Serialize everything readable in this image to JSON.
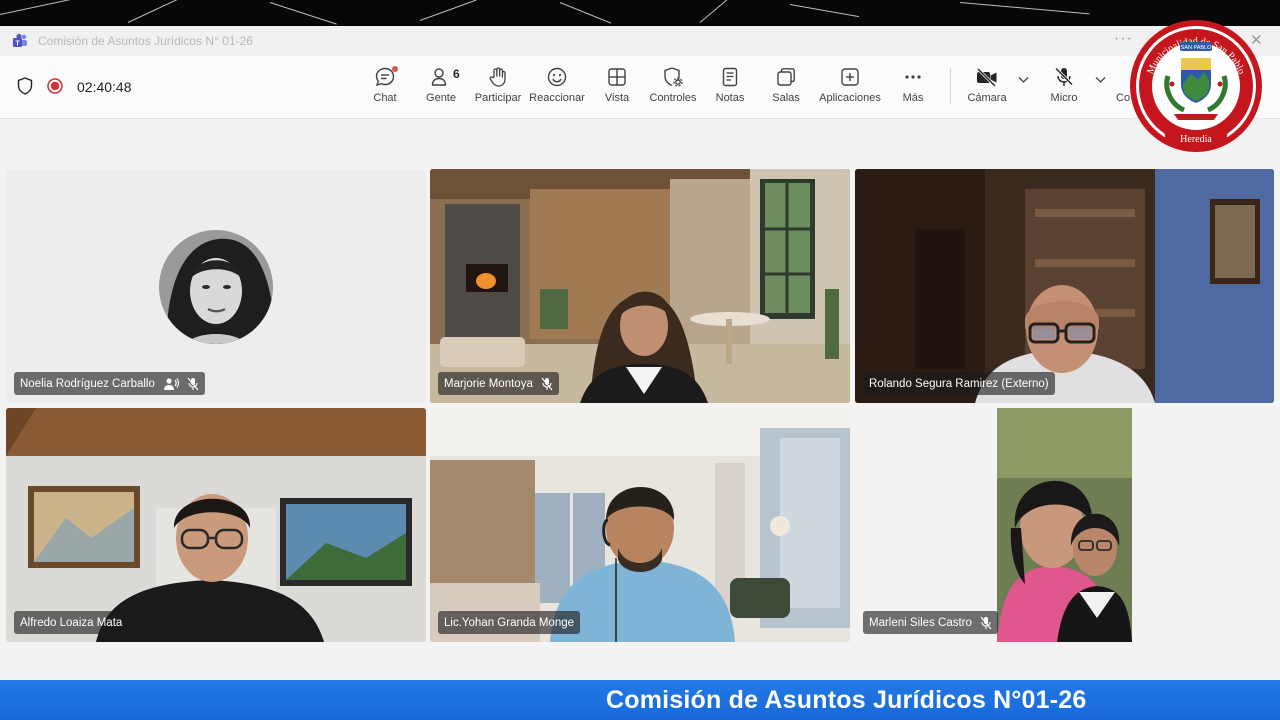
{
  "window": {
    "title": "Comisión de Asuntos Jurídicos N° 01-26"
  },
  "meeting": {
    "timer": "02:40:48"
  },
  "toolbar": {
    "chat_label": "Chat",
    "people_label": "Gente",
    "people_count": "6",
    "raise_label": "Participar",
    "react_label": "Reaccionar",
    "view_label": "Vista",
    "controls_label": "Controles",
    "notes_label": "Notas",
    "rooms_label": "Salas",
    "apps_label": "Aplicaciones",
    "more_label": "Más",
    "camera_label": "Cámara",
    "mic_label": "Micro",
    "share_label_partial": "Co"
  },
  "participants": [
    {
      "name": "Noelia Rodríguez Carballo",
      "muted": true,
      "video": false
    },
    {
      "name": "Marjorie Montoya",
      "muted": true,
      "video": true
    },
    {
      "name": "Rolando Segura Ramirez (Externo)",
      "muted": false,
      "video": true,
      "active_speaker": true
    },
    {
      "name": "Alfredo Loaiza Mata",
      "muted": false,
      "video": true
    },
    {
      "name": "Lic.Yohan Granda Monge",
      "muted": false,
      "video": true
    },
    {
      "name": "Marleni Siles Castro",
      "muted": true,
      "video": true
    }
  ],
  "banner": {
    "text": "Comisión de Asuntos Jurídicos N°01-26"
  },
  "seal": {
    "arc_text": "Municipalidad de San Pablo",
    "ribbon_text": "Heredia",
    "scroll_text": "SAN PABLO"
  },
  "colors": {
    "accent_blue": "#1a73e8",
    "active_speaker_border": "#7b7fd4",
    "record_red": "#d13438",
    "seal_red": "#c4161c"
  }
}
